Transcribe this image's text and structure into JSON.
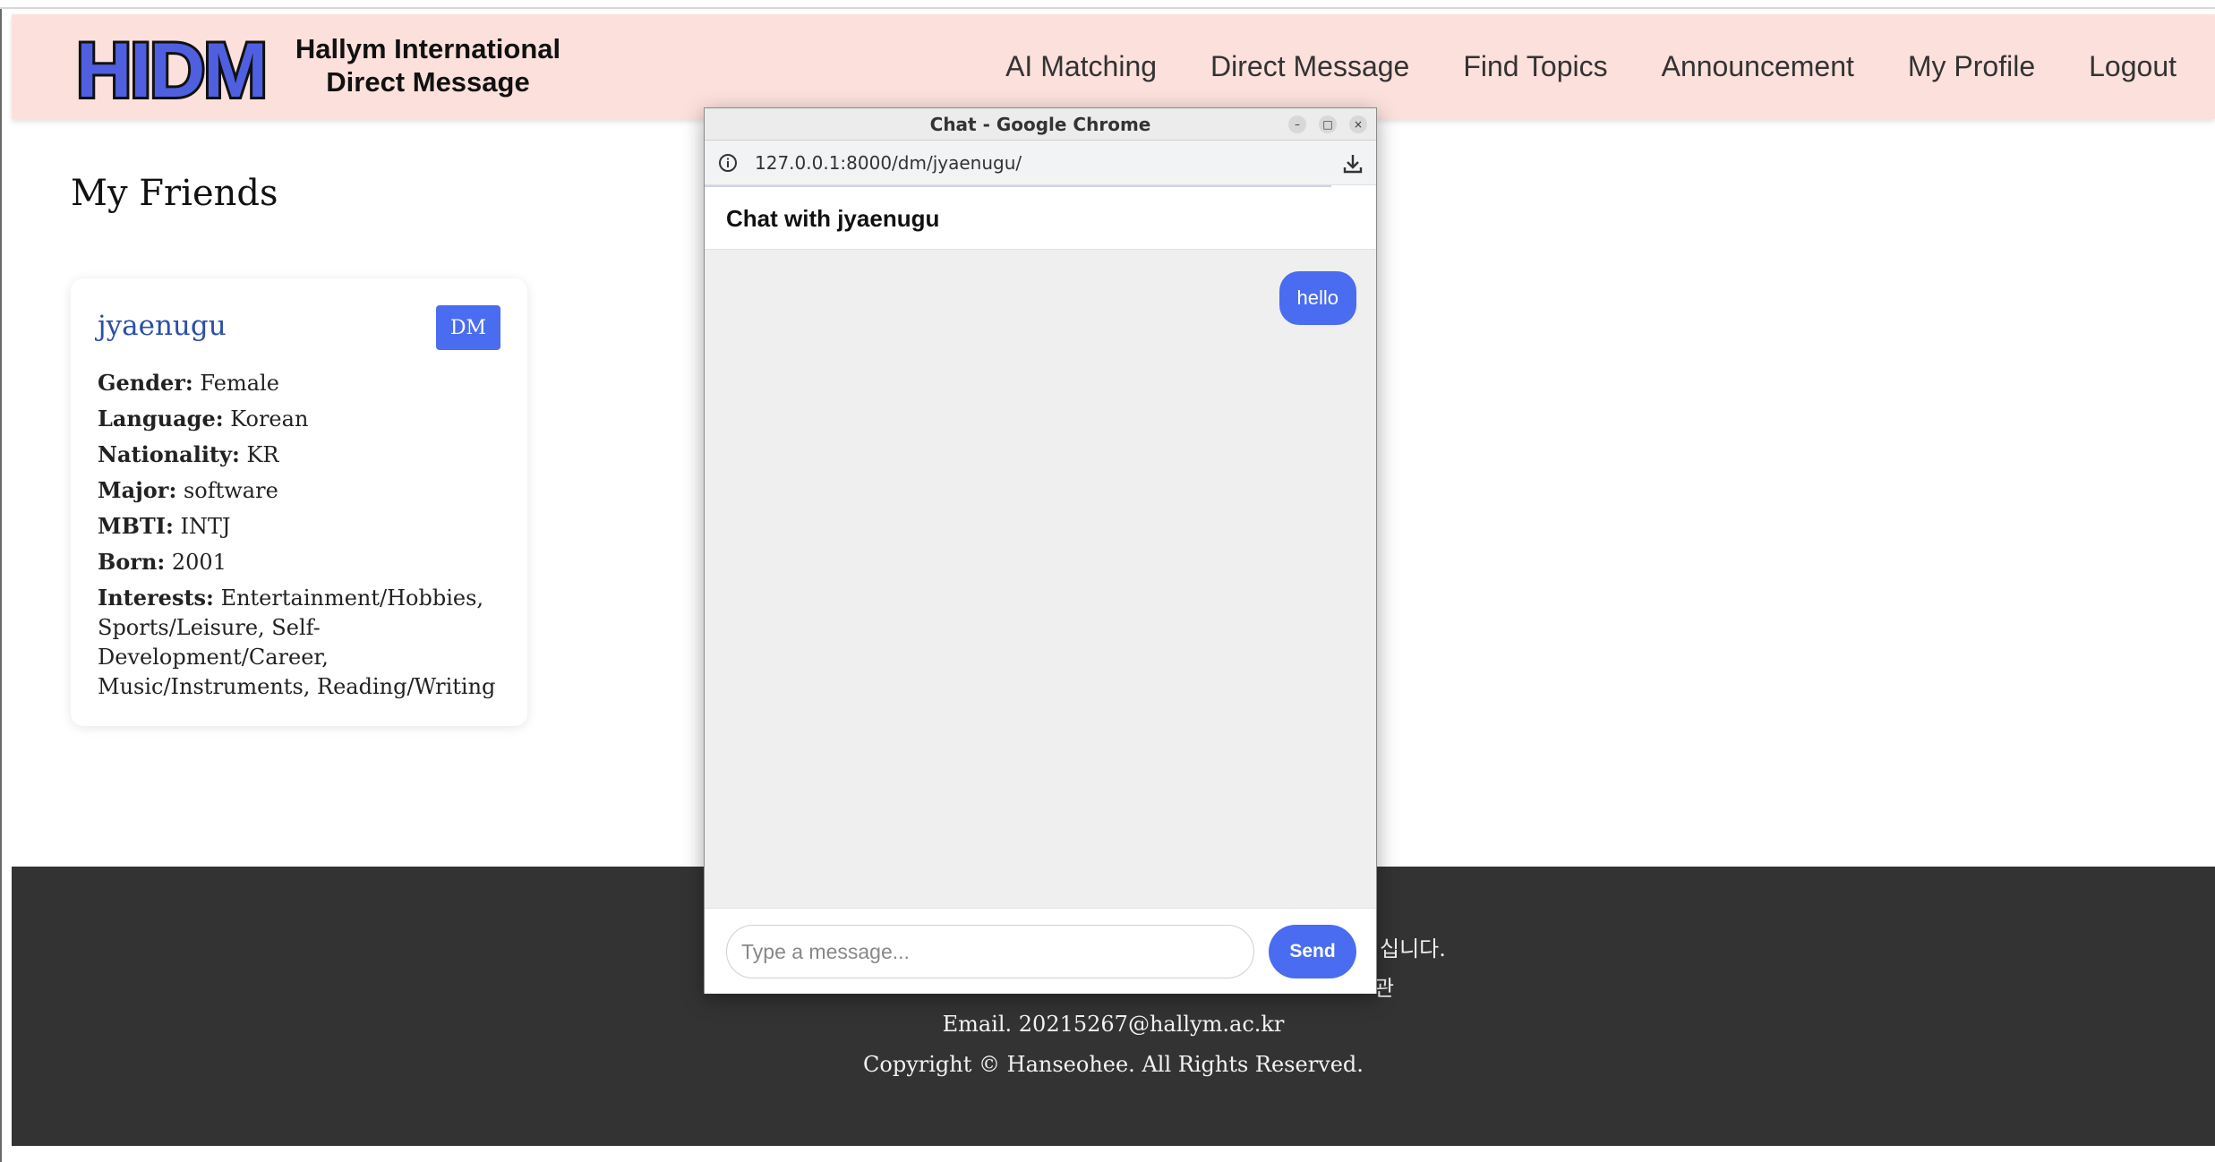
{
  "site": {
    "logo_text": "HIDM",
    "name_line1": "Hallym International",
    "name_line2": "Direct Message"
  },
  "nav": {
    "items": [
      {
        "label": "AI Matching"
      },
      {
        "label": "Direct Message"
      },
      {
        "label": "Find Topics"
      },
      {
        "label": "Announcement"
      },
      {
        "label": "My Profile"
      },
      {
        "label": "Logout"
      }
    ]
  },
  "friends": {
    "title": "My Friends",
    "card": {
      "name": "jyaenugu",
      "dm_label": "DM",
      "fields": [
        {
          "key": "Gender:",
          "value": "Female"
        },
        {
          "key": "Language:",
          "value": "Korean"
        },
        {
          "key": "Nationality:",
          "value": "KR"
        },
        {
          "key": "Major:",
          "value": "software"
        },
        {
          "key": "MBTI:",
          "value": "INTJ"
        },
        {
          "key": "Born:",
          "value": "2001"
        },
        {
          "key": "Interests:",
          "value": "Entertainment/Hobbies, Sports/Leisure, Self-Development/Career, Music/Instruments, Reading/Writing"
        }
      ]
    }
  },
  "footer": {
    "line1_partial": "십니다.",
    "line2_partial": "관",
    "email": "Email. 20215267@hallym.ac.kr",
    "copyright": "Copyright © Hanseohee. All Rights Reserved."
  },
  "popup": {
    "window_title": "Chat - Google Chrome",
    "url": "127.0.0.1:8000/dm/jyaenugu/",
    "chat_title": "Chat with jyaenugu",
    "messages": [
      {
        "text": "hello",
        "sender": "me"
      }
    ],
    "input_placeholder": "Type a message...",
    "send_label": "Send",
    "win_min": "–",
    "win_max": "□",
    "win_close": "×"
  },
  "colors": {
    "header_bg": "#fce0dc",
    "accent": "#4a6cf0",
    "footer_bg": "#333333",
    "friend_name": "#2a4fa8"
  }
}
